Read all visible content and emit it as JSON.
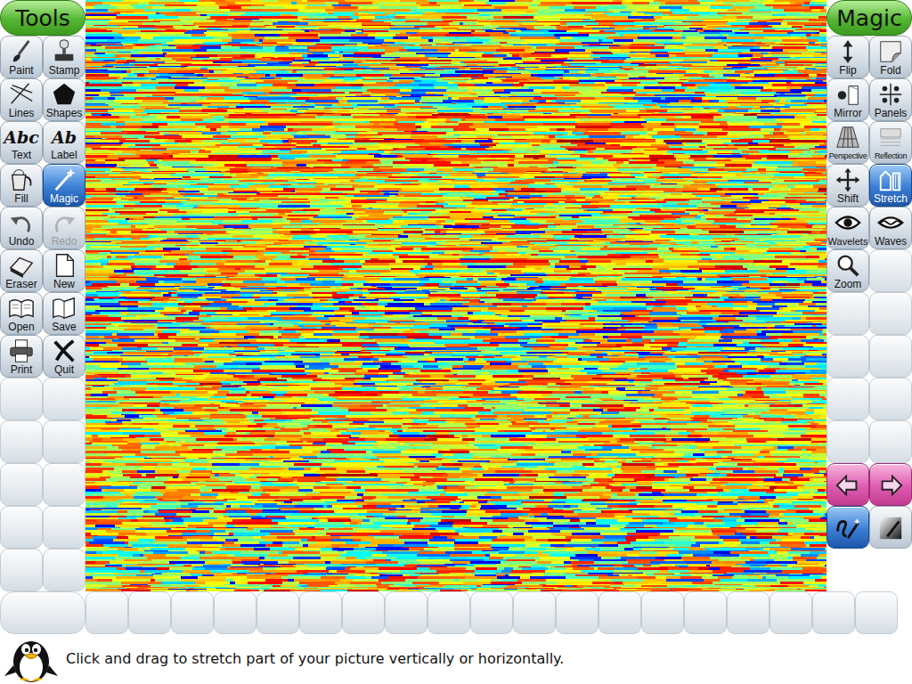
{
  "tools_header": "Tools",
  "tools": [
    {
      "label": "Paint",
      "selected": false,
      "disabled": false
    },
    {
      "label": "Stamp",
      "selected": false,
      "disabled": false
    },
    {
      "label": "Lines",
      "selected": false,
      "disabled": false
    },
    {
      "label": "Shapes",
      "selected": false,
      "disabled": false
    },
    {
      "label": "Text",
      "glyph": "Abc",
      "selected": false,
      "disabled": false
    },
    {
      "label": "Label",
      "glyph": "Ab",
      "selected": false,
      "disabled": false
    },
    {
      "label": "Fill",
      "selected": false,
      "disabled": false
    },
    {
      "label": "Magic",
      "selected": true,
      "disabled": false
    },
    {
      "label": "Undo",
      "selected": false,
      "disabled": false
    },
    {
      "label": "Redo",
      "selected": false,
      "disabled": true
    },
    {
      "label": "Eraser",
      "selected": false,
      "disabled": false
    },
    {
      "label": "New",
      "selected": false,
      "disabled": false
    },
    {
      "label": "Open",
      "selected": false,
      "disabled": false
    },
    {
      "label": "Save",
      "selected": false,
      "disabled": false
    },
    {
      "label": "Print",
      "selected": false,
      "disabled": false
    },
    {
      "label": "Quit",
      "selected": false,
      "disabled": false
    }
  ],
  "magic_header": "Magic",
  "magic": [
    {
      "label": "Flip",
      "selected": false
    },
    {
      "label": "Fold",
      "selected": false
    },
    {
      "label": "Mirror",
      "selected": false
    },
    {
      "label": "Panels",
      "selected": false
    },
    {
      "label": "Perspective",
      "selected": false
    },
    {
      "label": "Reflection",
      "selected": false
    },
    {
      "label": "Shift",
      "selected": false
    },
    {
      "label": "Stretch",
      "selected": true
    },
    {
      "label": "Wavelets",
      "selected": false
    },
    {
      "label": "Waves",
      "selected": false
    },
    {
      "label": "Zoom",
      "selected": false
    }
  ],
  "mode_buttons": [
    {
      "selected": true
    },
    {
      "selected": false
    }
  ],
  "status_text": "Click and drag to stretch part of your picture vertically or horizontally."
}
